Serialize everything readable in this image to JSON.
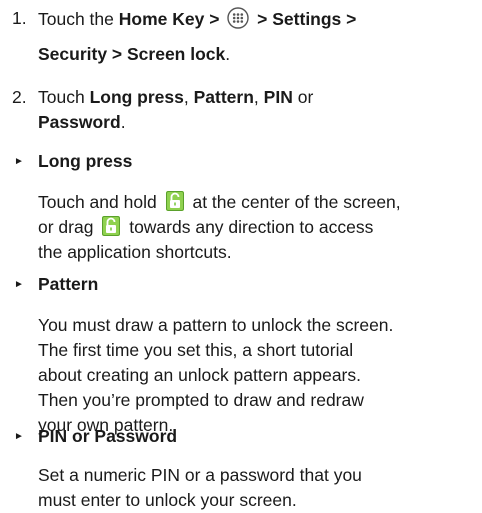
{
  "step1": {
    "number": "1.",
    "line1_prefix": "Touch the ",
    "home_key": "Home Key >",
    "path_rest": "> Settings >",
    "line2": "Security > Screen lock",
    "line2_suffix": "."
  },
  "step2": {
    "number": "2.",
    "prefix": "Touch ",
    "opt1": "Long press",
    "sep1": ", ",
    "opt2": "Pattern",
    "sep2": ", ",
    "opt3": "PIN",
    "sep3": " or",
    "opt4": "Password",
    "suffix": "."
  },
  "bullets": {
    "long_press": {
      "title": "Long press",
      "l1a": "Touch and hold",
      "l1b": "at the center of the screen,",
      "l2a": "or drag",
      "l2b": "towards any direction to access",
      "l3": "the application shortcuts."
    },
    "pattern": {
      "title": "Pattern",
      "lines": [
        "You must draw a pattern to unlock the screen.",
        "The first time you set this, a short tutorial",
        "about creating an unlock pattern appears.",
        "Then you’re prompted to draw and redraw",
        "your own pattern."
      ]
    },
    "pin": {
      "title": "PIN or Password",
      "lines": [
        "Set a numeric PIN or a password that you",
        "must enter to unlock your screen."
      ]
    }
  },
  "colors": {
    "lock_icon_green": "#7ac943",
    "apps_icon_stroke": "#555555"
  },
  "icons": {
    "apps": "apps-grid-icon",
    "lock": "unlock-padlock-icon"
  }
}
